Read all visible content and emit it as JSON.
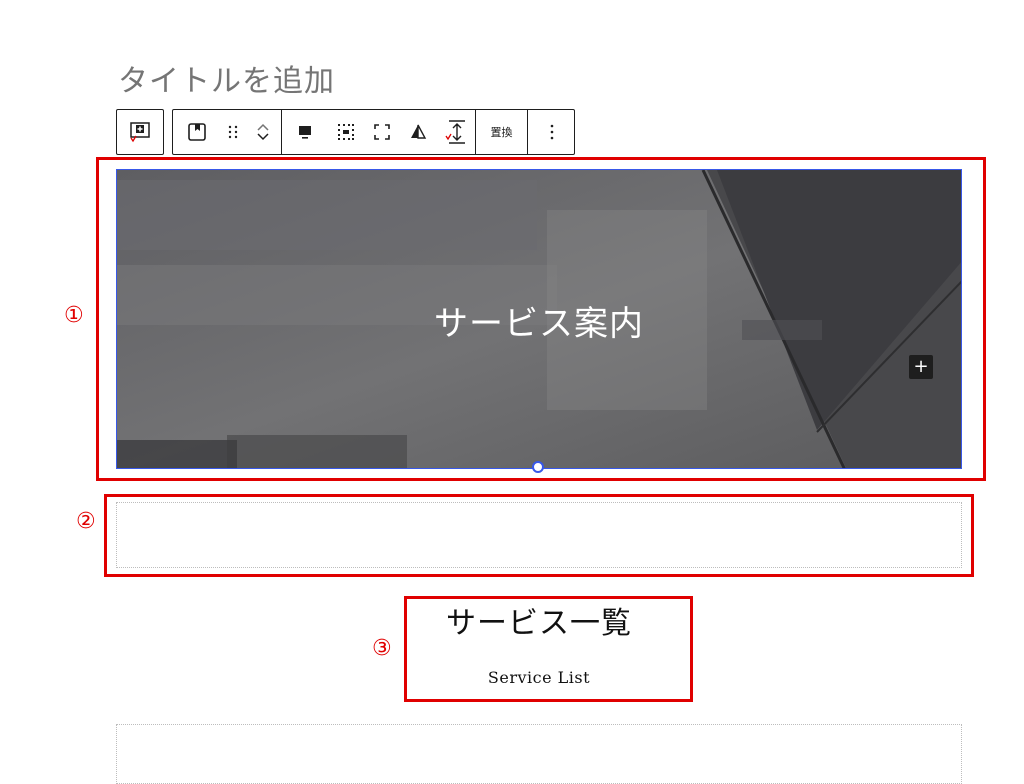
{
  "editor": {
    "title_placeholder": "タイトルを追加"
  },
  "toolbar": {
    "replace_label": "置換",
    "icons": [
      "cover-block-icon",
      "drag-handle-icon",
      "move-up-icon",
      "move-down-icon",
      "align-bottom-icon",
      "content-position-icon",
      "full-height-icon",
      "duotone-icon",
      "min-height-icon",
      "more-options-icon",
      "add-block-icon"
    ]
  },
  "cover": {
    "title": "サービス案内",
    "add_label": "+"
  },
  "section_heading": {
    "title": "サービス一覧",
    "subtitle": "Service List"
  },
  "annotations": {
    "one": "①",
    "two": "②",
    "three": "③"
  },
  "colors": {
    "annotation_red": "#e00000",
    "selection_blue": "#3858e9",
    "toolbar_border": "#1e1e1e"
  }
}
